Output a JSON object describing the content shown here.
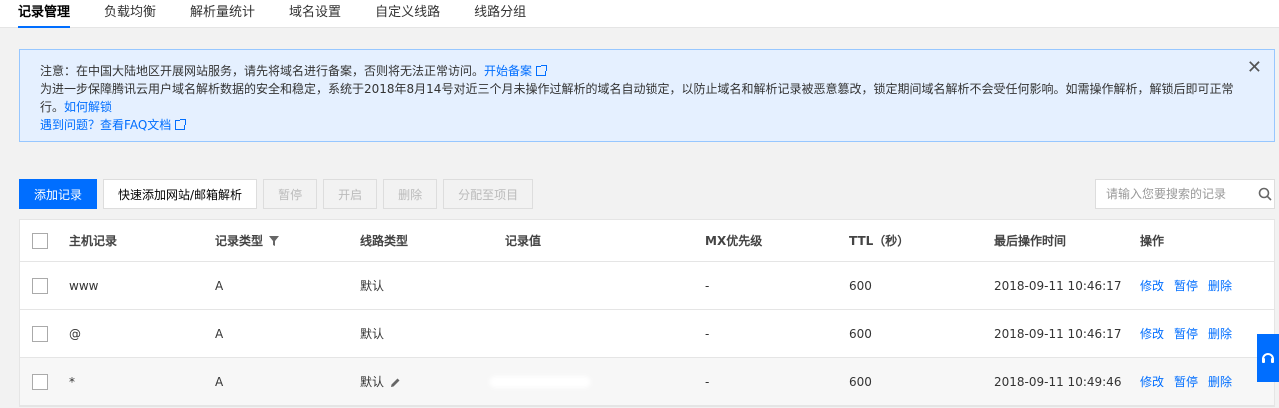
{
  "tabs": [
    {
      "label": "记录管理",
      "active": true
    },
    {
      "label": "负载均衡"
    },
    {
      "label": "解析量统计"
    },
    {
      "label": "域名设置"
    },
    {
      "label": "自定义线路"
    },
    {
      "label": "线路分组"
    }
  ],
  "notice": {
    "line1_text": "注意：在中国大陆地区开展网站服务，请先将域名进行备案，否则将无法正常访问。",
    "line1_link": "开始备案",
    "line2_text": "为进一步保障腾讯云用户域名解析数据的安全和稳定，系统于2018年8月14号对近三个月未操作过解析的域名自动锁定，以防止域名和解析记录被恶意篡改，锁定期间域名解析不会受任何影响。如需操作解析，解锁后即可正常进",
    "line3_text": "行。",
    "line3_link": "如何解锁",
    "line4_text": "遇到问题？",
    "line4_link": "查看FAQ文档"
  },
  "toolbar": {
    "add": "添加记录",
    "quick_add": "快速添加网站/邮箱解析",
    "pause": "暂停",
    "enable": "开启",
    "delete": "删除",
    "assign": "分配至项目"
  },
  "search": {
    "placeholder": "请输入您要搜索的记录"
  },
  "table": {
    "headers": {
      "host": "主机记录",
      "type": "记录类型",
      "line": "线路类型",
      "value": "记录值",
      "mx": "MX优先级",
      "ttl": "TTL（秒）",
      "time": "最后操作时间",
      "ops": "操作"
    },
    "rows": [
      {
        "host": "www",
        "type": "A",
        "line": "默认",
        "value": "",
        "mx": "-",
        "ttl": "600",
        "time": "2018-09-11 10:46:17"
      },
      {
        "host": "@",
        "type": "A",
        "line": "默认",
        "value": "",
        "mx": "-",
        "ttl": "600",
        "time": "2018-09-11 10:46:17"
      },
      {
        "host": "*",
        "type": "A",
        "line": "默认",
        "value": "",
        "mx": "-",
        "ttl": "600",
        "time": "2018-09-11 10:49:46"
      }
    ],
    "ops": {
      "edit": "修改",
      "pause": "暂停",
      "delete": "删除"
    }
  },
  "colors": {
    "accent": "#006eff",
    "notice_bg": "#e5f0ff",
    "notice_border": "#97c7ff"
  }
}
